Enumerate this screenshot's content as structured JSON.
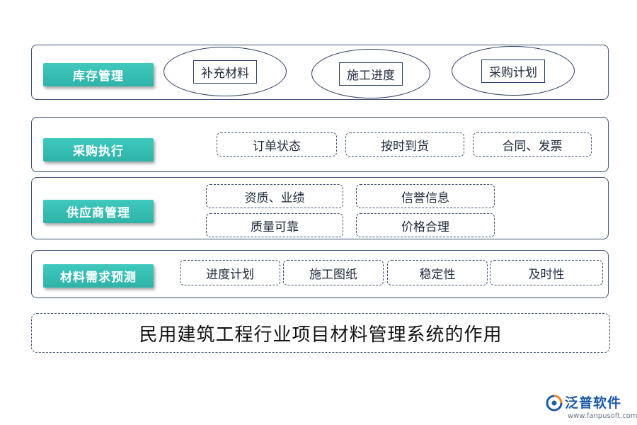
{
  "rows": {
    "inventory": {
      "label": "库存管理",
      "items": [
        "补充材料",
        "施工进度",
        "采购计划"
      ]
    },
    "procurement": {
      "label": "采购执行",
      "items": [
        "订单状态",
        "按时到货",
        "合同、发票"
      ]
    },
    "supplier": {
      "label": "供应商管理",
      "items": [
        "资质、业绩",
        "信誉信息",
        "质量可靠",
        "价格合理"
      ]
    },
    "forecast": {
      "label": "材料需求预测",
      "items": [
        "进度计划",
        "施工图纸",
        "稳定性",
        "及时性"
      ]
    }
  },
  "footer": {
    "title": "民用建筑工程行业项目材料管理系统的作用"
  },
  "brand": {
    "name": "泛普软件",
    "url": "www.fanpusoft.com",
    "icon": "fanpu-logo-icon",
    "color": "#1e5aa8"
  },
  "colors": {
    "tag": "#33bdb2",
    "border": "#3d4f73"
  }
}
